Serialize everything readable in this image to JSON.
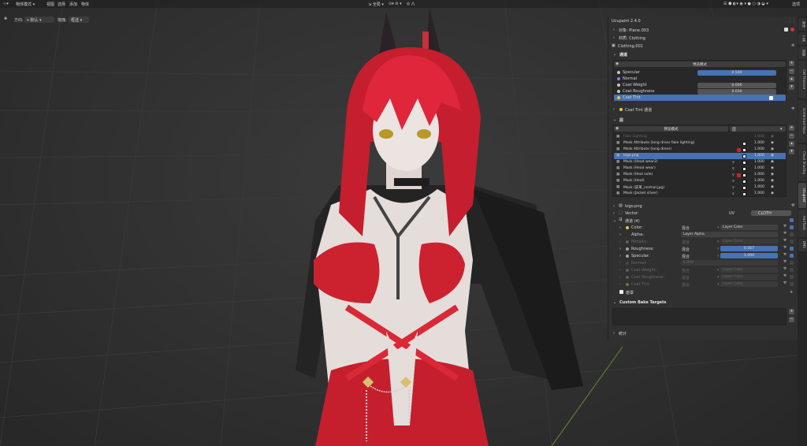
{
  "topbar": {
    "mode": "物体模式",
    "menu": [
      "视图",
      "选择",
      "添加",
      "物体"
    ],
    "global": "全局",
    "options": "选项"
  },
  "toolrow": {
    "orientation_label": "方向:",
    "orientation_value": "默认",
    "drag_label": "拖拽:",
    "drag_value": "框选"
  },
  "panel": {
    "title": "Ucupaint 2.4.0",
    "object": "对象: Plane.003",
    "material": "材质: Clothing",
    "node": "Clothing.001",
    "channels_header": "通道",
    "preset_mode": "预览模式",
    "channels": [
      {
        "name": "Specular",
        "value": "0.500",
        "color": "#c8c8c8",
        "blue": true
      },
      {
        "name": "Normal",
        "value": "",
        "color": "#8080ff",
        "blue": false
      },
      {
        "name": "Coat Weight",
        "value": "0.000",
        "color": "#c8c8c8",
        "blue": false
      },
      {
        "name": "Coat Roughness",
        "value": "0.030",
        "color": "#c8c8c8",
        "blue": false
      },
      {
        "name": "Coat Tint",
        "value": "",
        "color": "#e7c35a",
        "blue": false
      }
    ],
    "coat_tint_channel": "Coat Tint 通道",
    "layers_header": "层",
    "layer_preview": "预览模式",
    "layer_preview_value": "层",
    "layers": [
      {
        "name": "Fake Lighting",
        "value": "1.000",
        "dim": true
      },
      {
        "name": "Mask Attribute (long dress fake lighting)",
        "value": "1.000",
        "dim": false
      },
      {
        "name": "Mask Attribute (long dress)",
        "value": "1.000",
        "dim": false
      },
      {
        "name": "logo.png",
        "value": "1.000",
        "dim": false,
        "selected": true
      },
      {
        "name": "Mask (Head wear2)",
        "value": "1.000",
        "dim": false
      },
      {
        "name": "Mask (Head wear)",
        "value": "1.000",
        "dim": false
      },
      {
        "name": "Mask (Heal sole)",
        "value": "1.000",
        "dim": false
      },
      {
        "name": "Mask (Heal)",
        "value": "1.000",
        "dim": false
      },
      {
        "name": "Mask (皮革_normal.jpg)",
        "value": "1.000",
        "dim": false
      },
      {
        "name": "Mask (Jacket silver)",
        "value": "1.000",
        "dim": false
      }
    ],
    "image": "logo.png",
    "vector_label": "Vector:",
    "vector_uv": "UV",
    "vector_map": "CLOTH",
    "channel_count": "通道 (4)",
    "props": [
      {
        "name": "Color:",
        "blend": "混合",
        "value": "Layer Color",
        "dim": false,
        "blue": false,
        "color": "#e7c35a"
      },
      {
        "name": "Alpha:",
        "blend": "",
        "value": "Layer Alpha",
        "dim": false,
        "blue": false,
        "color": ""
      },
      {
        "name": "Metallic:",
        "blend": "混合",
        "value": "Layer Color",
        "dim": true,
        "blue": false,
        "color": "#a0a0a0"
      },
      {
        "name": "Roughness:",
        "blend": "混合",
        "value": "0.567",
        "dim": false,
        "blue": true,
        "color": "#a0a0a0"
      },
      {
        "name": "Specular:",
        "blend": "混合",
        "value": "1.000",
        "dim": false,
        "blue": true,
        "color": "#a0a0a0"
      },
      {
        "name": "Normal:",
        "blend": "",
        "value": "0.000",
        "dim": true,
        "blue": false,
        "color": "#6060c0"
      },
      {
        "name": "Coat Weight:",
        "blend": "混合",
        "value": "Layer Color",
        "dim": true,
        "blue": false,
        "color": "#a0a0a0"
      },
      {
        "name": "Coat Roughness:",
        "blend": "混合",
        "value": "Layer Color",
        "dim": true,
        "blue": false,
        "color": "#a0a0a0"
      },
      {
        "name": "Coat Tint:",
        "blend": "混合",
        "value": "Layer Color",
        "dim": true,
        "blue": false,
        "color": "#e7c35a"
      }
    ],
    "mask": "遮罩",
    "bake_header": "Custom Bake Targets",
    "stats": "统计"
  },
  "tabs": [
    "物体",
    "工具",
    "视图",
    "Cell Fracture",
    "Screencast Keys",
    "Cloud Shading",
    "Ucupaint",
    "HairTools",
    "BMV"
  ],
  "colors": {
    "accent": "#4772b3",
    "panel": "#303030",
    "hair": "#d8243a",
    "dress": "#c9202e"
  }
}
